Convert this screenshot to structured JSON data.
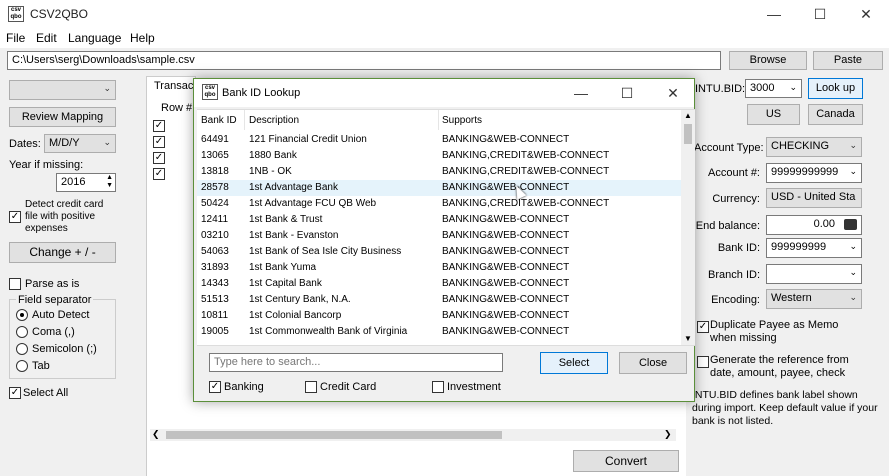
{
  "window": {
    "title": "CSV2QBO",
    "icon_text": "csv\nqbo"
  },
  "menu": [
    "File",
    "Edit",
    "Language",
    "Help"
  ],
  "path": {
    "value": "C:\\Users\\serg\\Downloads\\sample.csv",
    "browse": "Browse",
    "paste": "Paste"
  },
  "left": {
    "review_mapping": "Review Mapping",
    "dates_label": "Dates:",
    "dates_value": "M/D/Y",
    "year_label": "Year if missing:",
    "year_value": "2016",
    "detect_credit": "Detect credit card file with positive expenses",
    "change_sign": "Change + / -",
    "parse_as_is": "Parse as is",
    "field_separator": "Field separator",
    "separators": [
      "Auto Detect",
      "Coma (,)",
      "Semicolon (;)",
      "Tab"
    ],
    "select_all": "Select All"
  },
  "middle": {
    "tab_label": "Transact",
    "row_header": "Row #",
    "convert": "Convert"
  },
  "right": {
    "intu_bid_label": "INTU.BID:",
    "intu_bid_value": "3000",
    "lookup": "Look up",
    "us": "US",
    "canada": "Canada",
    "account_type_label": "Account Type:",
    "account_type_value": "CHECKING",
    "account_num_label": "Account #:",
    "account_num_value": "99999999999",
    "currency_label": "Currency:",
    "currency_value": "USD - United Sta",
    "end_balance_label": "End balance:",
    "end_balance_value": "0.00",
    "bank_id_label": "Bank ID:",
    "bank_id_value": "999999999",
    "branch_id_label": "Branch ID:",
    "branch_id_value": "",
    "encoding_label": "Encoding:",
    "encoding_value": "Western",
    "dup_payee": "Duplicate Payee as Memo when missing",
    "gen_ref": "Generate the reference from date, amount, payee, check",
    "info": "INTU.BID defines bank label shown during import. Keep default value if your bank is not listed."
  },
  "dialog": {
    "title": "Bank ID Lookup",
    "columns": [
      "Bank ID",
      "Description",
      "Supports"
    ],
    "rows": [
      [
        "64491",
        "121 Financial Credit Union",
        "BANKING&WEB-CONNECT"
      ],
      [
        "13065",
        "1880 Bank",
        "BANKING,CREDIT&WEB-CONNECT"
      ],
      [
        "13818",
        "1NB - OK",
        "BANKING,CREDIT&WEB-CONNECT"
      ],
      [
        "28578",
        "1st Advantage Bank",
        "BANKING&WEB-CONNECT"
      ],
      [
        "50424",
        "1st Advantage FCU QB Web",
        "BANKING,CREDIT&WEB-CONNECT"
      ],
      [
        "12411",
        "1st Bank & Trust",
        "BANKING&WEB-CONNECT"
      ],
      [
        "03210",
        "1st Bank - Evanston",
        "BANKING&WEB-CONNECT"
      ],
      [
        "54063",
        "1st Bank of Sea Isle City Business",
        "BANKING&WEB-CONNECT"
      ],
      [
        "31893",
        "1st Bank Yuma",
        "BANKING&WEB-CONNECT"
      ],
      [
        "14343",
        "1st Capital Bank",
        "BANKING&WEB-CONNECT"
      ],
      [
        "51513",
        "1st Century Bank, N.A.",
        "BANKING&WEB-CONNECT"
      ],
      [
        "10811",
        "1st Colonial Bancorp",
        "BANKING&WEB-CONNECT"
      ],
      [
        "19005",
        "1st Commonwealth Bank of Virginia",
        "BANKING&WEB-CONNECT"
      ]
    ],
    "search_placeholder": "Type here to search...",
    "select": "Select",
    "close": "Close",
    "filters": [
      "Banking",
      "Credit Card",
      "Investment"
    ]
  }
}
